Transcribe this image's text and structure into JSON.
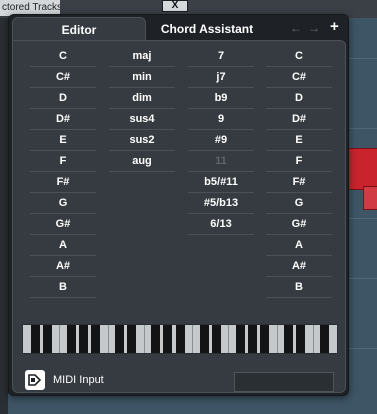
{
  "background": {
    "tracks_label": "ctored Tracks",
    "close_glyph": "X"
  },
  "tabs": {
    "editor": "Editor",
    "chord_assistant": "Chord Assistant",
    "prev_icon": "arrow-left-icon",
    "next_icon": "arrow-right-icon",
    "add_label": "+"
  },
  "columns": {
    "root": [
      "C",
      "C#",
      "D",
      "D#",
      "E",
      "F",
      "F#",
      "G",
      "G#",
      "A",
      "A#",
      "B"
    ],
    "quality": [
      "maj",
      "min",
      "dim",
      "sus4",
      "sus2",
      "aug"
    ],
    "extension": [
      "7",
      "j7",
      "b9",
      "9",
      "#9",
      "11",
      "b5/#11",
      "#5/b13",
      "6/13"
    ],
    "bass": [
      "C",
      "C#",
      "D",
      "D#",
      "E",
      "F",
      "F#",
      "G",
      "G#",
      "A",
      "A#",
      "B"
    ]
  },
  "disabled_extension": "11",
  "midi": {
    "label": "MIDI Input",
    "icon": "midi-input-icon",
    "value": ""
  },
  "colors": {
    "panel": "#353b40",
    "text": "#ffffff",
    "disabled": "#5e656a",
    "event_red": "#c9242d"
  }
}
